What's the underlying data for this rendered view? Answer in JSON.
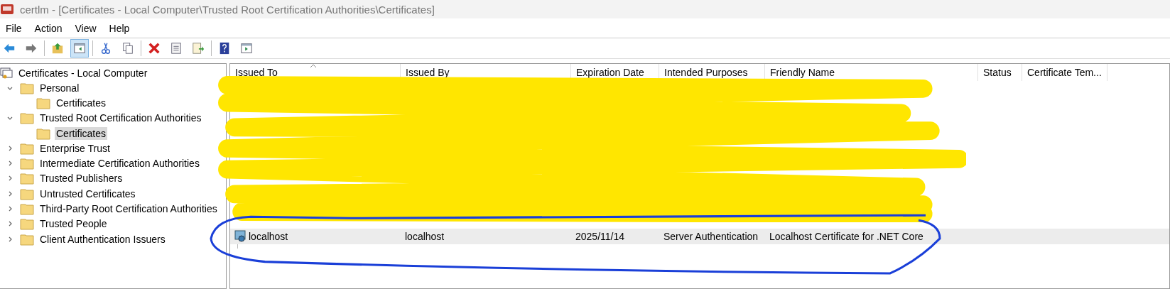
{
  "window": {
    "title": "certlm - [Certificates - Local Computer\\Trusted Root Certification Authorities\\Certificates]"
  },
  "menu": [
    "File",
    "Action",
    "View",
    "Help"
  ],
  "toolbar": [
    {
      "kind": "back",
      "pressed": false
    },
    {
      "kind": "forward",
      "pressed": false
    },
    {
      "kind": "sep"
    },
    {
      "kind": "up",
      "pressed": false
    },
    {
      "kind": "tree",
      "pressed": true
    },
    {
      "kind": "sep"
    },
    {
      "kind": "cut",
      "pressed": false
    },
    {
      "kind": "copy",
      "pressed": false
    },
    {
      "kind": "sep"
    },
    {
      "kind": "delete",
      "pressed": false
    },
    {
      "kind": "properties",
      "pressed": false
    },
    {
      "kind": "export",
      "pressed": false
    },
    {
      "kind": "sep"
    },
    {
      "kind": "help",
      "pressed": false
    },
    {
      "kind": "pane",
      "pressed": false
    }
  ],
  "tree": {
    "label": "Certificates - Local Computer",
    "children": [
      {
        "label": "Personal",
        "expanded": true,
        "selected": false,
        "children": [
          {
            "label": "Certificates",
            "selected": false
          }
        ]
      },
      {
        "label": "Trusted Root Certification Authorities",
        "expanded": true,
        "selected": false,
        "children": [
          {
            "label": "Certificates",
            "selected": true
          }
        ]
      },
      {
        "label": "Enterprise Trust",
        "expanded": false,
        "selected": false
      },
      {
        "label": "Intermediate Certification Authorities",
        "expanded": false,
        "selected": false
      },
      {
        "label": "Trusted Publishers",
        "expanded": false,
        "selected": false
      },
      {
        "label": "Untrusted Certificates",
        "expanded": false,
        "selected": false
      },
      {
        "label": "Third-Party Root Certification Authorities",
        "expanded": false,
        "selected": false
      },
      {
        "label": "Trusted People",
        "expanded": false,
        "selected": false
      },
      {
        "label": "Client Authentication Issuers",
        "expanded": false,
        "selected": false
      }
    ]
  },
  "table": {
    "columns": [
      "Issued To",
      "Issued By",
      "Expiration Date",
      "Intended Purposes",
      "Friendly Name",
      "Status",
      "Certificate Tem..."
    ],
    "rows": [
      {
        "cells": [
          "localhost",
          "localhost",
          "2025/11/14",
          "Server Authentication",
          "Localhost Certificate for .NET Core"
        ],
        "selected": true
      }
    ]
  }
}
